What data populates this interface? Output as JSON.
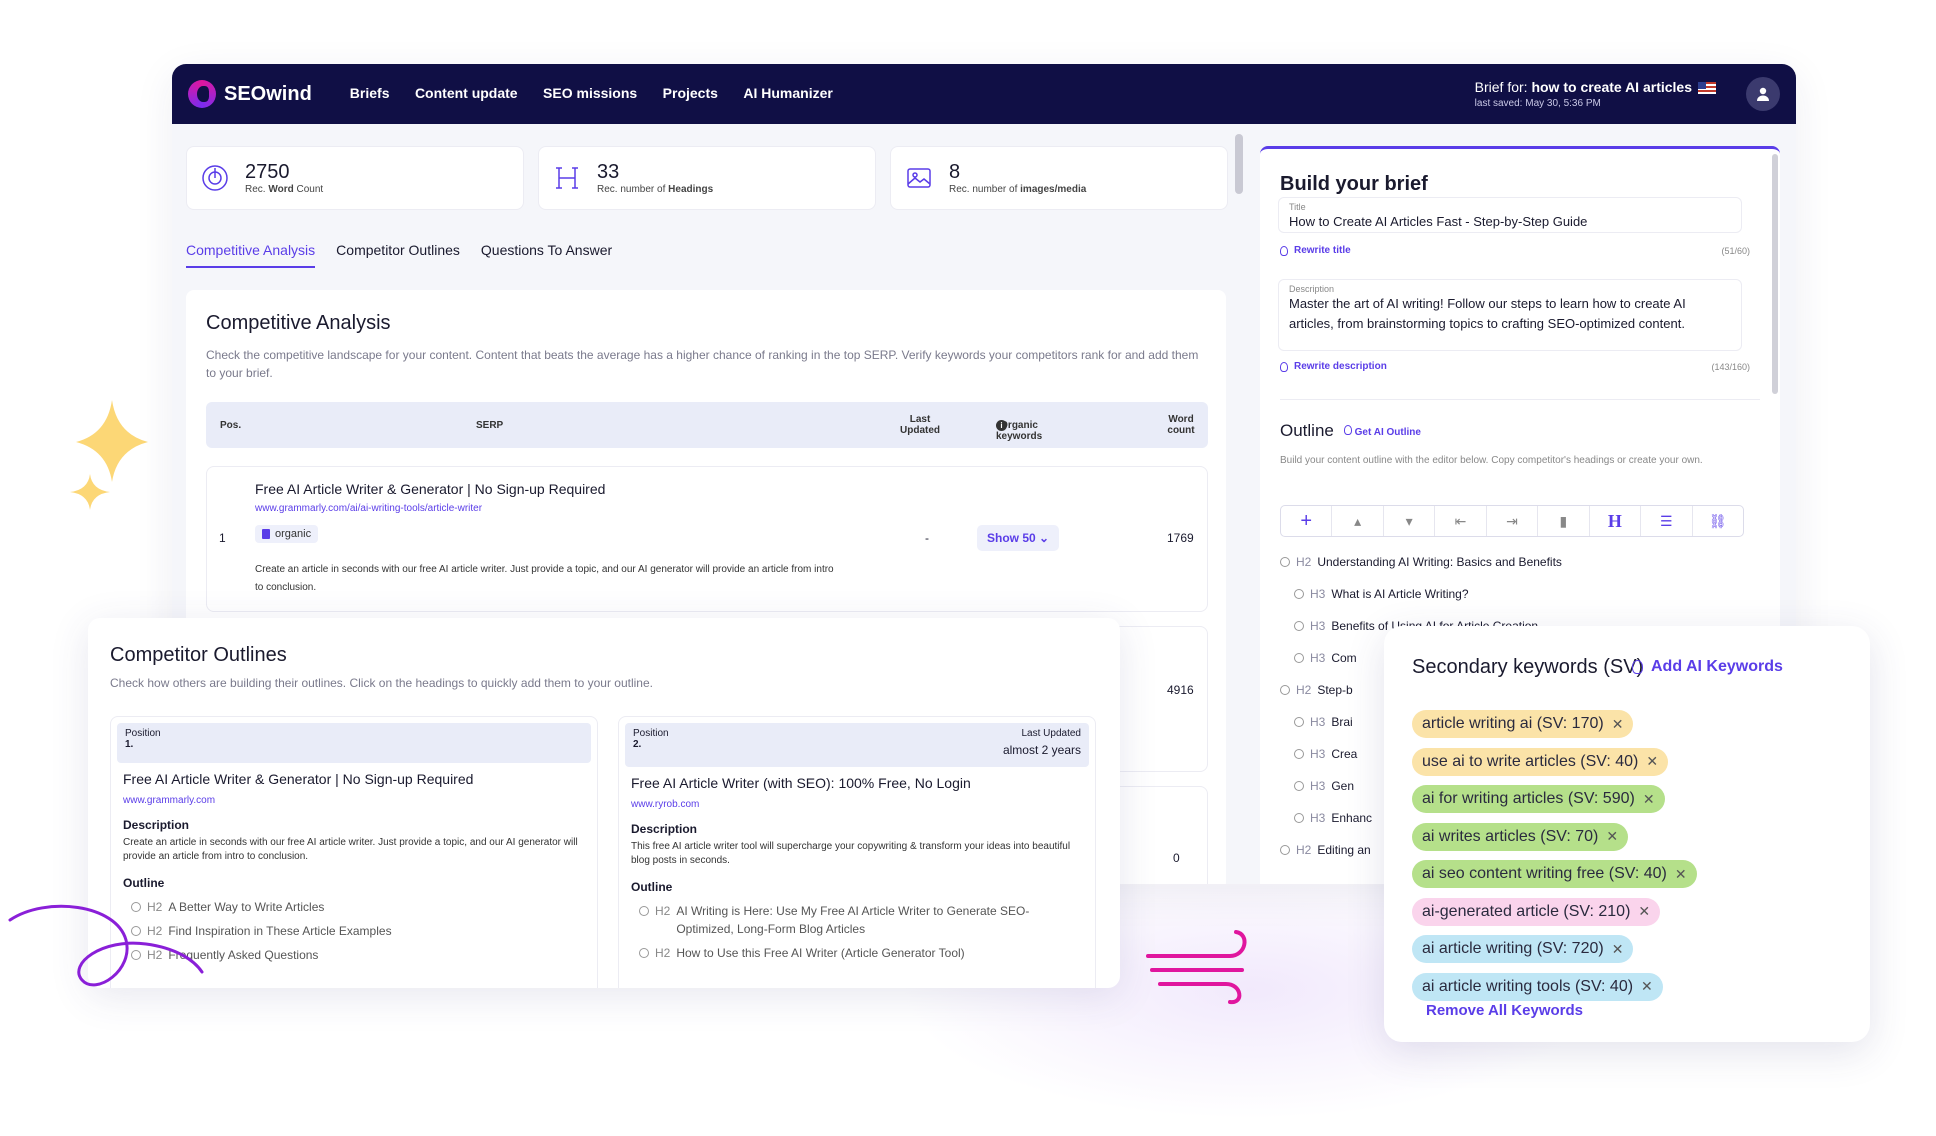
{
  "header": {
    "brand": "SEOwind",
    "nav": [
      "Briefs",
      "Content update",
      "SEO missions",
      "Projects",
      "AI Humanizer"
    ],
    "brief_for_label": "Brief for:",
    "brief_for_value": "how to create AI articles",
    "last_saved": "last saved: May 30, 5:36 PM"
  },
  "stats": [
    {
      "value": "2750",
      "label_prefix": "Rec.",
      "label_bold": "Word",
      "label_suffix": "Count"
    },
    {
      "value": "33",
      "label_prefix": "Rec. number of",
      "label_bold": "Headings",
      "label_suffix": ""
    },
    {
      "value": "8",
      "label_prefix": "Rec. number of",
      "label_bold": "images/media",
      "label_suffix": ""
    }
  ],
  "tabs": [
    "Competitive Analysis",
    "Competitor Outlines",
    "Questions To Answer"
  ],
  "competitive": {
    "title": "Competitive Analysis",
    "description": "Check the competitive landscape for your content. Content that beats the average has a higher chance of ranking in the top SERP. Verify keywords your competitors rank for and add them to your brief.",
    "columns": {
      "pos": "Pos.",
      "serp": "SERP",
      "last_updated": "Last Updated",
      "organic": "Organic keywords",
      "word_count": "Word count"
    },
    "rows": [
      {
        "pos": "1",
        "title": "Free AI Article Writer & Generator | No Sign-up Required",
        "url": "www.grammarly.com/ai/ai-writing-tools/article-writer",
        "badge": "organic",
        "snippet": "Create an article in seconds with our free AI article writer. Just provide a topic, and our AI generator will provide an article from intro to conclusion.",
        "last_updated": "-",
        "organic_button": "Show 50",
        "word_count": "1769"
      },
      {
        "word_count": "4916"
      },
      {
        "word_count": "0"
      }
    ]
  },
  "brief": {
    "heading": "Build your brief",
    "title_label": "Title",
    "title_value": "How to Create AI Articles Fast - Step-by-Step Guide",
    "rewrite_title": "Rewrite title",
    "title_count": "(51/60)",
    "description_label": "Description",
    "description_value": "Master the art of AI writing! Follow our steps to learn how to create AI articles, from brainstorming topics to crafting SEO-optimized content.",
    "rewrite_description": "Rewrite description",
    "description_count": "(143/160)",
    "outline_heading": "Outline",
    "get_ai_outline": "Get AI Outline",
    "outline_help": "Build your content outline with the editor below. Copy competitor's headings or create your own.",
    "toolbar_icons": [
      "plus-icon",
      "move-up-icon",
      "move-down-icon",
      "outdent-icon",
      "indent-icon",
      "trash-icon",
      "heading-icon",
      "list-icon",
      "link-icon"
    ],
    "outline": [
      {
        "tag": "H2",
        "text": "Understanding AI Writing: Basics and Benefits"
      },
      {
        "tag": "H3",
        "text": "What is AI Article Writing?"
      },
      {
        "tag": "H3",
        "text": "Benefits of Using AI for Article Creation"
      },
      {
        "tag": "H3",
        "text": "Com"
      },
      {
        "tag": "H2",
        "text": "Step-b"
      },
      {
        "tag": "H3",
        "text": "Brai"
      },
      {
        "tag": "H3",
        "text": "Crea"
      },
      {
        "tag": "H3",
        "text": "Gen"
      },
      {
        "tag": "H3",
        "text": "Enhanc"
      },
      {
        "tag": "H2",
        "text": "Editing an"
      }
    ]
  },
  "competitor_outlines": {
    "title": "Competitor Outlines",
    "description": "Check how others are building their outlines. Click on the headings to quickly add them to your outline.",
    "cards": [
      {
        "position_label": "Position",
        "position": "1.",
        "last_updated_label": "",
        "last_updated": "",
        "title": "Free AI Article Writer & Generator | No Sign-up Required",
        "url": "www.grammarly.com",
        "description_label": "Description",
        "description": "Create an article in seconds with our free AI article writer. Just provide a topic, and our AI generator will provide an article from intro to conclusion.",
        "outline_label": "Outline",
        "outline": [
          {
            "tag": "H2",
            "text": "A Better Way to Write Articles"
          },
          {
            "tag": "H2",
            "text": "Find Inspiration in These  Article Examples"
          },
          {
            "tag": "H2",
            "text": "Frequently Asked Questions"
          }
        ]
      },
      {
        "position_label": "Position",
        "position": "2.",
        "last_updated_label": "Last Updated",
        "last_updated": "almost 2 years",
        "title": "Free AI Article Writer (with SEO): 100% Free, No Login",
        "url": "www.ryrob.com",
        "description_label": "Description",
        "description": "This free AI article writer tool will supercharge your copywriting & transform your ideas into beautiful blog posts in seconds.",
        "outline_label": "Outline",
        "outline": [
          {
            "tag": "H2",
            "text": "AI Writing is Here: Use My Free AI Article Writer to Generate SEO-Optimized, Long-Form Blog Articles"
          },
          {
            "tag": "H2",
            "text": "How to Use this Free AI Writer (Article Generator Tool)"
          }
        ]
      }
    ]
  },
  "secondary_keywords": {
    "title": "Secondary keywords (SV)",
    "add_ai": "Add AI Keywords",
    "remove_all": "Remove All Keywords",
    "chips": [
      {
        "text": "article writing ai (SV: 170)",
        "color": "#fbe3a8"
      },
      {
        "text": "use ai to write articles (SV: 40)",
        "color": "#fbe3a8"
      },
      {
        "text": "ai for writing articles (SV: 590)",
        "color": "#b5e08a"
      },
      {
        "text": "ai writes articles (SV: 70)",
        "color": "#b5e08a"
      },
      {
        "text": "ai seo content writing free (SV: 40)",
        "color": "#b5e08a"
      },
      {
        "text": "ai-generated article (SV: 210)",
        "color": "#fad4ec"
      },
      {
        "text": "ai article writing (SV: 720)",
        "color": "#bfe6f5"
      },
      {
        "text": "ai article writing tools (SV: 40)",
        "color": "#bfe6f5"
      }
    ]
  },
  "colors": {
    "accent": "#5a3de8",
    "topbar": "#100f45",
    "sparkle": "#fcd776",
    "swirl": "#8a1fd8",
    "wind": "#e0169e"
  }
}
